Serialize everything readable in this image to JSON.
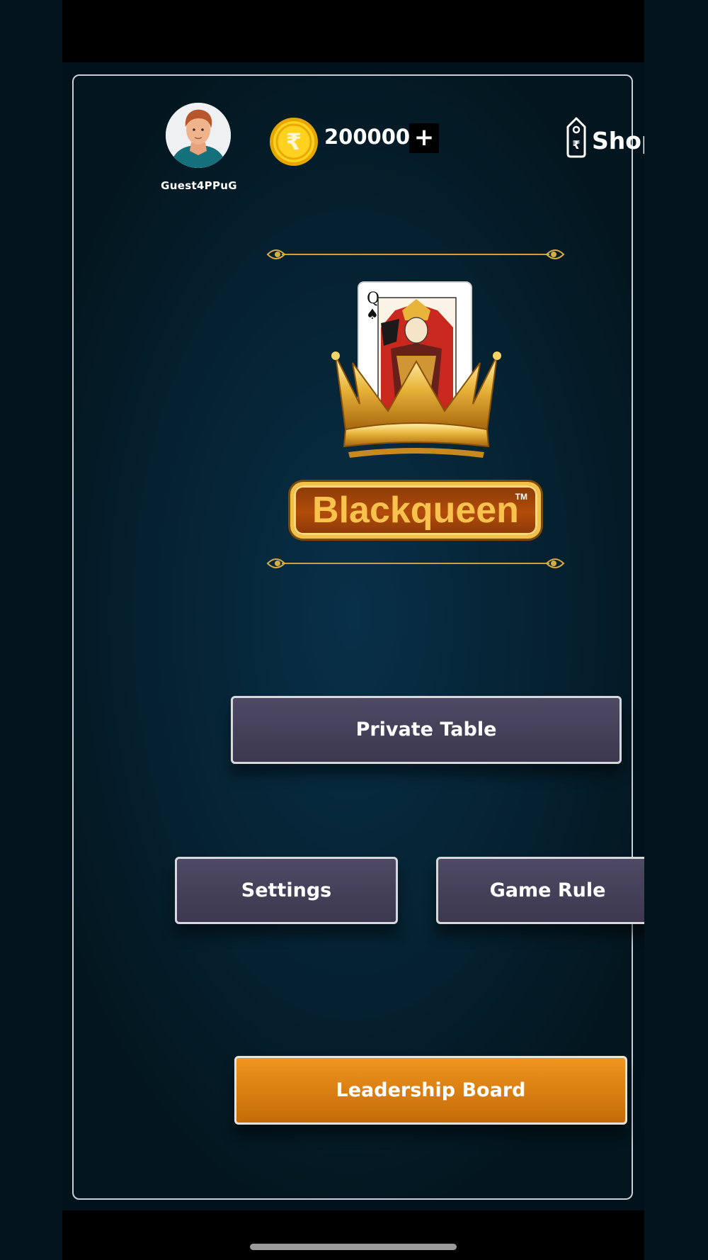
{
  "player": {
    "name": "Guest4PPuG"
  },
  "wallet": {
    "balance": "200000",
    "add_label": "+",
    "currency_icon": "rupee-coin-icon"
  },
  "shop": {
    "label": "Shop",
    "icon": "rupee-tag-icon"
  },
  "logo": {
    "brand": "Blackqueen",
    "tm": "TM",
    "card_rank": "Q",
    "card_suit": "♠"
  },
  "menu": {
    "private_table": "Private Table",
    "settings": "Settings",
    "game_rule": "Game Rule",
    "leaderboard": "Leadership Board"
  },
  "colors": {
    "gold": "#f2c14a",
    "accent_orange": "#f0951f",
    "button": "#46425a",
    "background": "#062536"
  }
}
